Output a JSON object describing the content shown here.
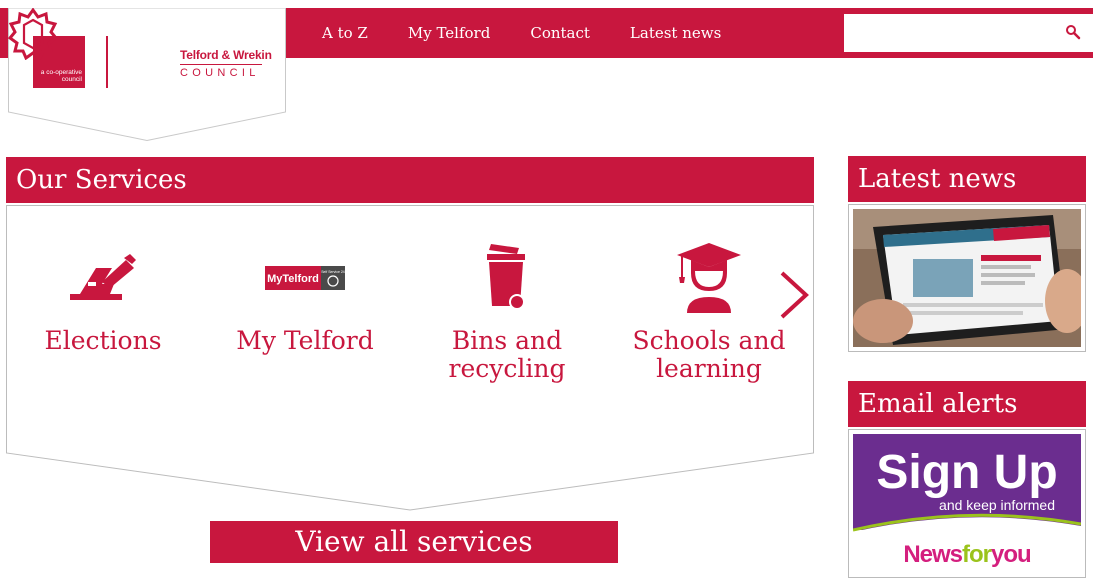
{
  "header": {
    "coop_label": "a co-operative council",
    "council_name": "Telford & Wrekin",
    "council_word": "COUNCIL",
    "nav": [
      "A to Z",
      "My Telford",
      "Contact",
      "Latest news"
    ],
    "search_placeholder": ""
  },
  "services": {
    "heading": "Our Services",
    "items": [
      {
        "label": "Elections",
        "icon": "ballot-icon"
      },
      {
        "label": "My Telford",
        "icon": "mytelford-logo-icon",
        "badge_text": "MyTelford",
        "badge_sub": "Self Service 24"
      },
      {
        "label": "Bins and recycling",
        "icon": "wheelie-bin-icon"
      },
      {
        "label": "Schools and learning",
        "icon": "graduate-icon"
      }
    ],
    "next_icon": "chevron-right-icon",
    "view_all": "View all services"
  },
  "sidebar": {
    "news_heading": "Latest news",
    "alerts_heading": "Email alerts",
    "signup_title": "Sign Up",
    "signup_sub": "and keep informed",
    "signup_brand_a": "News",
    "signup_brand_b": "for",
    "signup_brand_c": "you"
  },
  "colors": {
    "brand": "#c8173e",
    "signup_purple": "#6b2d8f",
    "signup_green": "#9bc31c",
    "signup_magenta": "#d41f7e"
  }
}
